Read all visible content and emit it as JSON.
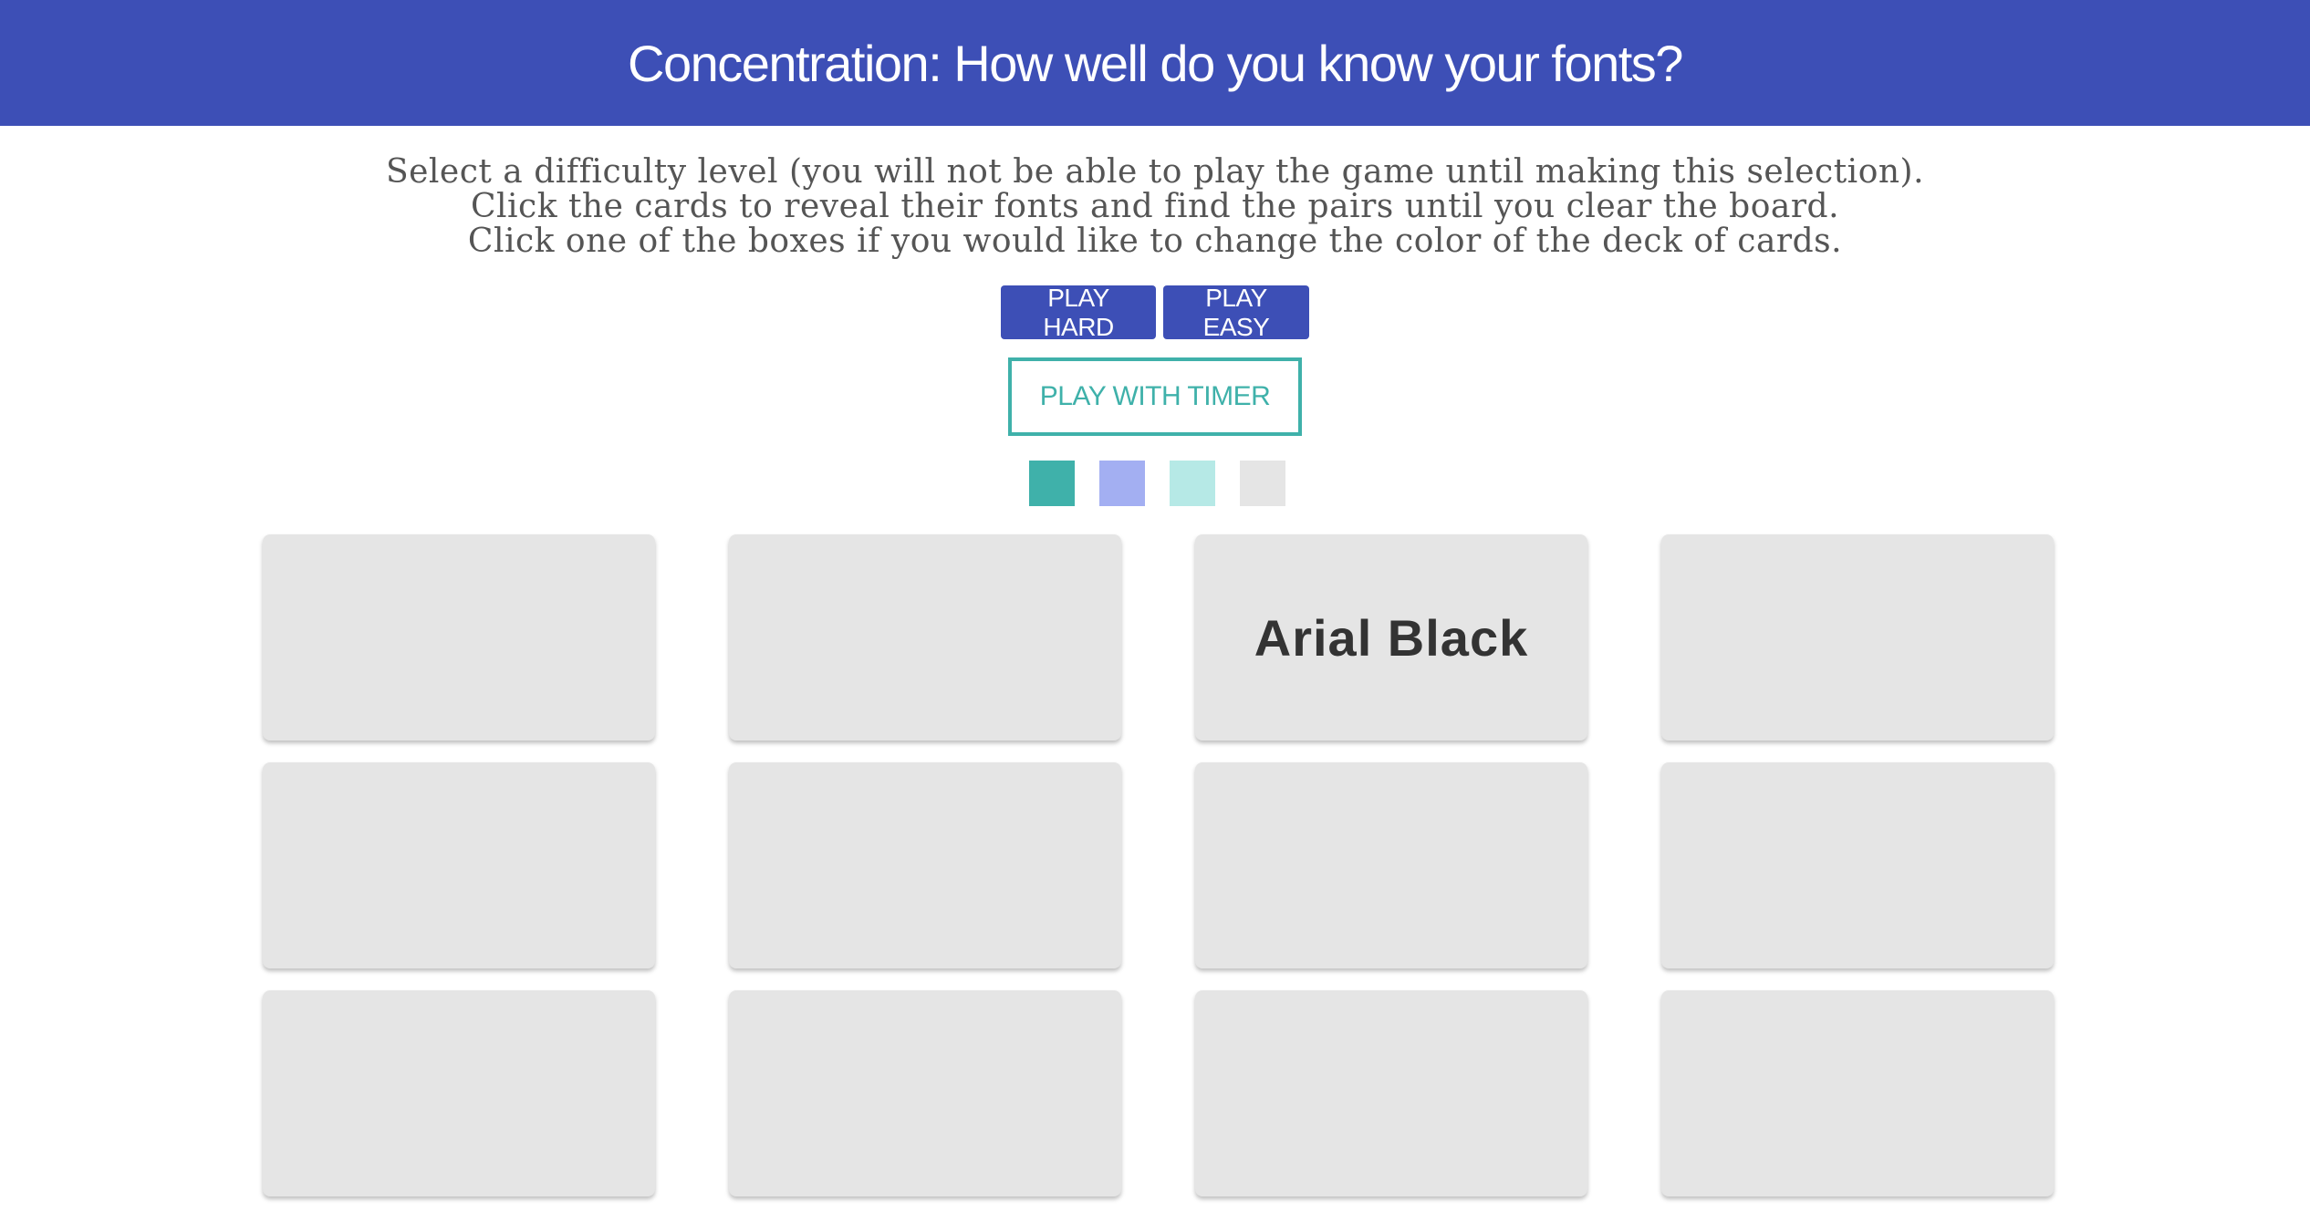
{
  "header": {
    "title": "Concentration: How well do you know your fonts?"
  },
  "instructions": {
    "lines": [
      "Select a difficulty level (you will not be able to play the game until making this selection).",
      "Click the cards to reveal their fonts and find the pairs until you clear the board.",
      "Click one of the boxes if you would like to change the color of the deck of cards."
    ]
  },
  "buttons": {
    "play_hard": "PLAY HARD",
    "play_easy": "PLAY EASY",
    "play_timer": "PLAY WITH TIMER"
  },
  "colors": {
    "header_bg": "#3d4fb6",
    "accent": "#3fb1aa",
    "card_bg": "#e5e5e5"
  },
  "swatches": [
    {
      "name": "teal",
      "color": "#3fb1aa"
    },
    {
      "name": "periwinkle",
      "color": "#a3aff2"
    },
    {
      "name": "light-aqua",
      "color": "#b6e9e6"
    },
    {
      "name": "light-gray",
      "color": "#e5e5e5"
    }
  ],
  "cards": [
    {
      "label": "",
      "revealed": false
    },
    {
      "label": "",
      "revealed": false
    },
    {
      "label": "Arial Black",
      "revealed": true
    },
    {
      "label": "",
      "revealed": false
    },
    {
      "label": "",
      "revealed": false
    },
    {
      "label": "",
      "revealed": false
    },
    {
      "label": "",
      "revealed": false
    },
    {
      "label": "",
      "revealed": false
    },
    {
      "label": "",
      "revealed": false
    },
    {
      "label": "",
      "revealed": false
    },
    {
      "label": "",
      "revealed": false
    },
    {
      "label": "",
      "revealed": false
    }
  ]
}
